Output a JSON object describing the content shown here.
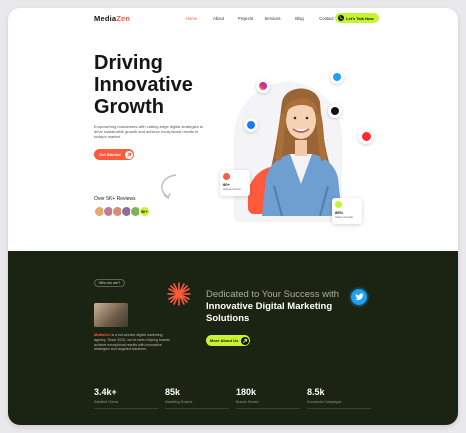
{
  "nav": {
    "logo_main": "Media",
    "logo_accent": "Zen",
    "links": [
      "Home",
      "About",
      "Projects",
      "Services",
      "Blog",
      "Contact"
    ],
    "active": "Home",
    "cta": "Let's Talk Now"
  },
  "hero": {
    "title": "Driving Innovative Growth",
    "description": "Empowering businesses with cutting-edge digital strategies to drive sustainable growth and achieve exceptional results in today's market.",
    "button": "Get Started",
    "reviews_label": "Over 5K+ Reviews",
    "reviews_badge": "5K+",
    "card_left": {
      "value": "80+",
      "label": "Award winner"
    },
    "card_right": {
      "value": "85%",
      "label": "Sales Growth"
    }
  },
  "about": {
    "pill": "Who we are?",
    "brand": "MediaZen",
    "text": " is a full-service digital marketing agency. Since 2020, we've been helping brands achieve exceptional results with innovative strategies and targeted solutions.",
    "headline_light": "Dedicated to Your Success with ",
    "headline_strong": "Innovative Digital Marketing Solutions",
    "button": "More About Us"
  },
  "stats": [
    {
      "value": "3.4k+",
      "label": "Satisfied Clients"
    },
    {
      "value": "85k",
      "label": "Marketing Experts"
    },
    {
      "value": "180k",
      "label": "Brands Served"
    },
    {
      "value": "8.5k",
      "label": "Successful Campaigns"
    }
  ],
  "colors": {
    "accent": "#ff5a3c",
    "lime": "#c6f432",
    "dark": "#1b2312"
  }
}
